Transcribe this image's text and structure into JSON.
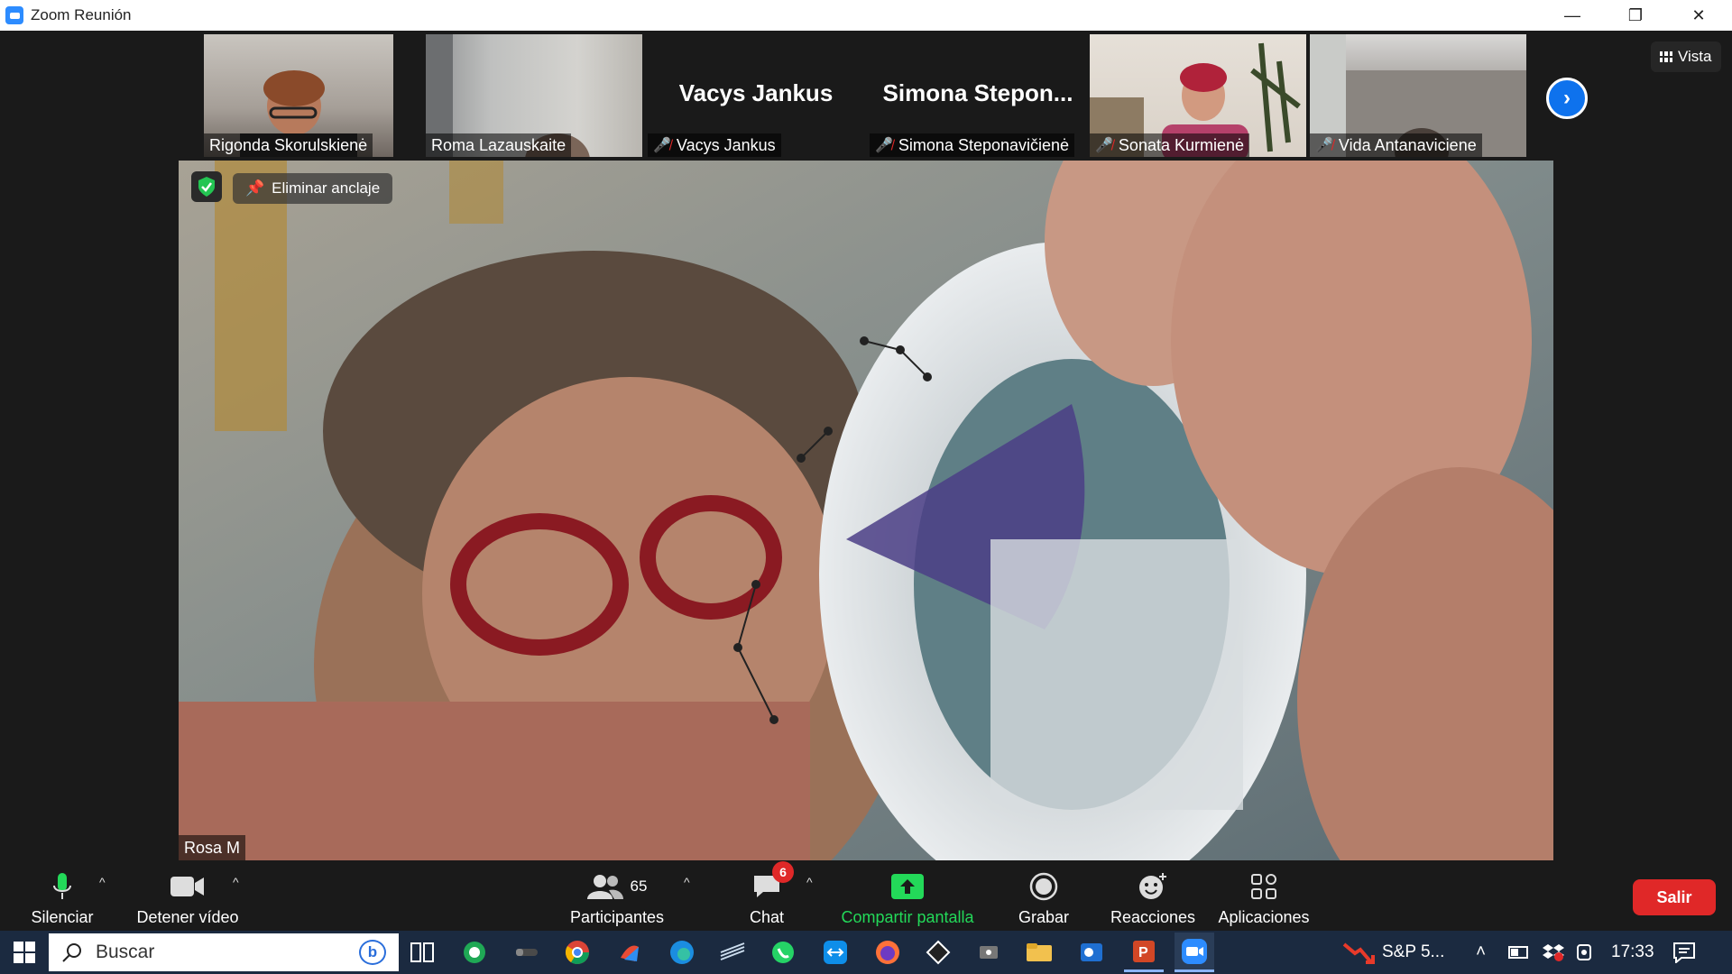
{
  "window": {
    "title": "Zoom Reunión",
    "minimize": "—",
    "restore": "❐",
    "close": "✕"
  },
  "participants_strip": [
    {
      "name": "Rigonda Skorulskienė",
      "muted": false,
      "video": true
    },
    {
      "name": "Roma Lazauskaite",
      "muted": false,
      "video": true
    },
    {
      "name": "Vacys Jankus",
      "display": "Vacys Jankus",
      "muted": true,
      "video": false
    },
    {
      "name": "Simona Steponavičienė",
      "display": "Simona  Stepon...",
      "muted": true,
      "video": false
    },
    {
      "name": "Sonata Kurmienė",
      "muted": true,
      "video": true
    },
    {
      "name": "Vida Antanaviciene",
      "muted": true,
      "video": true
    }
  ],
  "view_button": {
    "label": "Vista"
  },
  "main_video": {
    "name": "Rosa M",
    "unpin_label": "Eliminar anclaje"
  },
  "toolbar": {
    "mute": "Silenciar",
    "stop_video": "Detener vídeo",
    "participants": "Participantes",
    "participants_count": "65",
    "chat": "Chat",
    "chat_badge": "6",
    "share": "Compartir pantalla",
    "record": "Grabar",
    "reactions": "Reacciones",
    "apps": "Aplicaciones",
    "leave": "Salir"
  },
  "taskbar": {
    "search_placeholder": "Buscar",
    "bing": "b",
    "stock_widget": "S&P 5...",
    "time": "17:33"
  },
  "colors": {
    "accent": "#2d8cff",
    "leave": "#e02828",
    "share": "#23d959",
    "taskbar": "#1b2a40"
  }
}
